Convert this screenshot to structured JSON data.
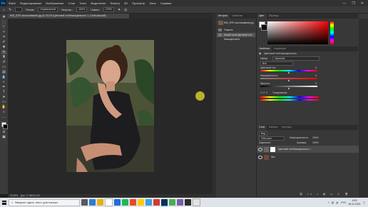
{
  "app": {
    "logo": "Ps"
  },
  "menu": {
    "items": [
      "Файл",
      "Редактирование",
      "Изображение",
      "Слои",
      "Текст",
      "Выделение",
      "Фильтр",
      "3D",
      "Просмотр",
      "Окно",
      "Справка"
    ]
  },
  "window_controls": {
    "minimize": "—",
    "maximize": "❐",
    "close": "✕"
  },
  "options_bar": {
    "mode_label": "Режим:",
    "mode_value": "Нормальный",
    "opacity_label": "Непрозр.:",
    "opacity_value": "100%",
    "flow_label": "Нажим:",
    "flow_value": "100%"
  },
  "document": {
    "tab_title": "IMG_8791 мотоназвание.jpg @ 33,3% (Цветовой тон/Насыщенность 1, Слой-маска/8)"
  },
  "status_bar": {
    "zoom": "33,33%",
    "info": "Док: 17,0M/34,1M"
  },
  "history_panel": {
    "tabs": [
      "История",
      "Свойства"
    ],
    "rows": [
      "IMG_8791 мотоназвание.jpg",
      "Открыть",
      "Новый слой Цветовой тон/Насыщенность"
    ]
  },
  "color_panel": {
    "tabs": [
      "Цвет",
      "Образцы"
    ]
  },
  "properties_panel": {
    "tabs": [
      "Свойства",
      "Коррекция"
    ],
    "title": "Цветовой тон/Насыщенность",
    "preset_label": "Набор:",
    "preset_value": "Заказная",
    "channel_value": "Всё",
    "hue_label": "Цветовой тон:",
    "hue_value": "0",
    "saturation_label": "Насыщенность:",
    "saturation_value": "0",
    "lightness_label": "Яркость:",
    "lightness_value": "0",
    "colorize_label": "Тонирование",
    "hue_level": 0.5,
    "saturation_level": 0.5,
    "lightness_level": 0.5
  },
  "layers_panel": {
    "tabs": [
      "Слои",
      "Каналы",
      "Контуры"
    ],
    "filter_label": "Вид",
    "blend_mode": "Обычные",
    "opacity_label": "Непрозрачность:",
    "opacity_value": "100%",
    "lock_label": "Закрепить:",
    "fill_label": "Заливка:",
    "fill_value": "100%",
    "layers": [
      "Цветовой тон/Насыщенность 1",
      "Фон"
    ]
  },
  "taskbar": {
    "search_placeholder": "Введите здесь текст для поиска",
    "time": "6:29",
    "date": "18.11.2021",
    "language": "РУС"
  },
  "colors": {
    "accent": "#31a8ff",
    "panel": "#383838",
    "canvas": "#282828"
  }
}
